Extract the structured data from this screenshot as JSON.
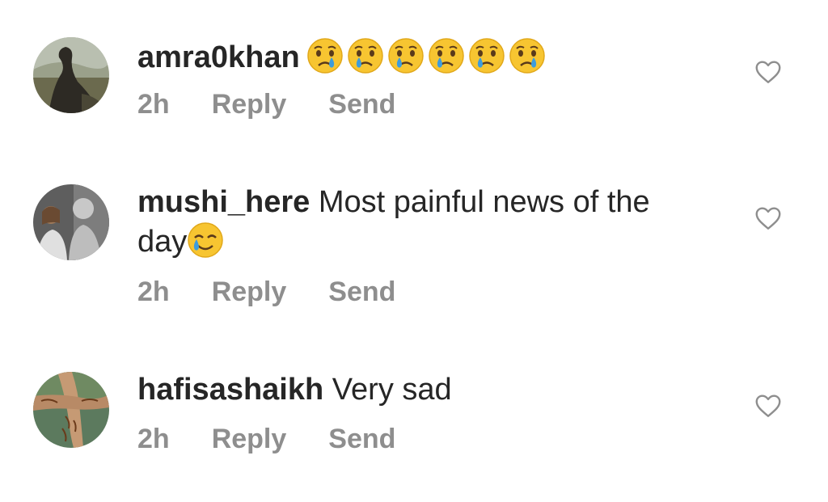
{
  "comments": [
    {
      "username": "amra0khan",
      "text": "",
      "emoji": [
        "crying-face",
        "crying-face",
        "crying-face",
        "crying-face",
        "crying-face",
        "crying-face"
      ],
      "time": "2h",
      "reply_label": "Reply",
      "send_label": "Send",
      "like_icon": "heart-outline-icon"
    },
    {
      "username": "mushi_here",
      "text_line1": "Most painful news of the",
      "text_line2": "day",
      "emoji": [
        "smiling-face-with-tear"
      ],
      "time": "2h",
      "reply_label": "Reply",
      "send_label": "Send",
      "like_icon": "heart-outline-icon"
    },
    {
      "username": "hafisashaikh",
      "text": "Very sad",
      "time": "2h",
      "reply_label": "Reply",
      "send_label": "Send",
      "like_icon": "heart-outline-icon"
    }
  ],
  "colors": {
    "text": "#262626",
    "meta": "#8e8e8e",
    "emoji_face": "#f7c531",
    "tear": "#3d9cdc"
  }
}
